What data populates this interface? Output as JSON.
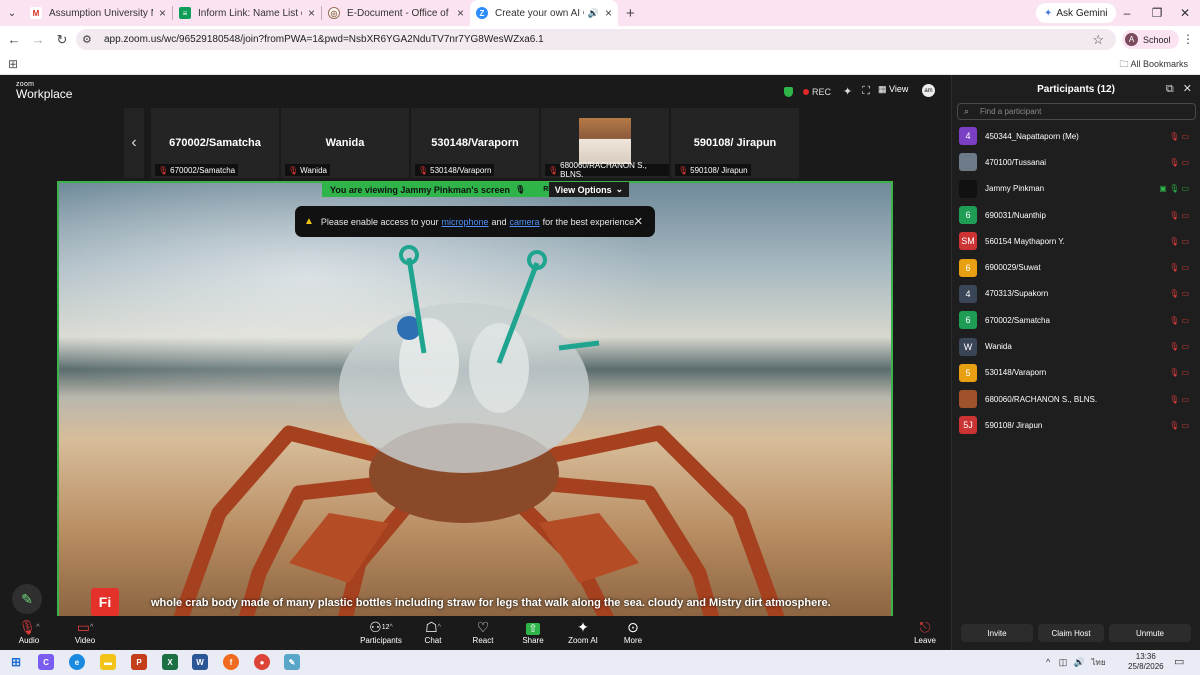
{
  "browser": {
    "tabs": [
      {
        "title": "Assumption University Mail",
        "icon": "gmail-icon",
        "color": "#d93025",
        "glyph": "M"
      },
      {
        "title": "Inform Link: Name List of Partic",
        "icon": "sheets-icon",
        "color": "#0f9d58",
        "glyph": "≡"
      },
      {
        "title": "E-Document - Office of the Vic",
        "icon": "edoc-icon",
        "color": "#9a6b4f",
        "glyph": "◎"
      },
      {
        "title": "Create your own AI Chatbo",
        "icon": "zoom-icon",
        "color": "#2d8cff",
        "glyph": "Z"
      }
    ],
    "ask_gemini": "Ask Gemini",
    "url": "app.zoom.us/wc/96529180548/join?fromPWA=1&pwd=NsbXR6YGA2NduTV7nr7YG8WesWZxa6.1",
    "profile": {
      "initial": "A",
      "label": "School"
    },
    "all_bookmarks": "All Bookmarks"
  },
  "zoom": {
    "logo_small": "zoom",
    "logo_big": "Workplace",
    "rec": "REC",
    "view": "View",
    "gallery": [
      {
        "name": "670002/Samatcha",
        "label": "670002/Samatcha"
      },
      {
        "name": "Wanida",
        "label": "Wanida"
      },
      {
        "name": "530148/Varaporn",
        "label": "530148/Varaporn"
      },
      {
        "name": "",
        "label": "680060/RACHANON S., BLNS."
      },
      {
        "name": "590108/ Jirapun",
        "label": "590108/ Jirapun"
      }
    ],
    "viewing_banner": "You are viewing  Jammy Pinkman's screen",
    "viewing_rec": "REC",
    "view_options": "View Options",
    "toast": {
      "before": "Please enable access to your",
      "mic_link": "microphone",
      "and": "and",
      "cam_link": "camera",
      "after": "for the best experience."
    },
    "fi_badge": "Fi",
    "caption": "whole crab body made of many plastic bottles including straw for legs that walk along the sea. cloudy and Mistry dirt atmosphere.",
    "toolbar": {
      "audio": "Audio",
      "video": "Video",
      "participants": "Participants",
      "participants_count": "12",
      "chat": "Chat",
      "react": "React",
      "share": "Share",
      "zoom_ai": "Zoom AI",
      "more": "More",
      "leave": "Leave"
    }
  },
  "participants": {
    "title": "Participants (12)",
    "search_placeholder": "Find a participant",
    "list": [
      {
        "initial": "4",
        "name": "450344_Napattaporn (Me)",
        "color": "#7b3fc4"
      },
      {
        "initial": "",
        "name": "470100/Tussanai",
        "color": "#6d7a88"
      },
      {
        "initial": "",
        "name": "Jammy Pinkman",
        "color": "#111111"
      },
      {
        "initial": "6",
        "name": "690031/Nuanthip",
        "color": "#1f9d55"
      },
      {
        "initial": "SM",
        "name": "560154 Maythaporn Y.",
        "color": "#cc3333"
      },
      {
        "initial": "6",
        "name": "6900029/Suwat",
        "color": "#e8a012"
      },
      {
        "initial": "4",
        "name": "470313/Supakorn",
        "color": "#3a4658"
      },
      {
        "initial": "6",
        "name": "670002/Samatcha",
        "color": "#1f9d55"
      },
      {
        "initial": "W",
        "name": "Wanida",
        "color": "#3a4658"
      },
      {
        "initial": "5",
        "name": "530148/Varaporn",
        "color": "#e8a012"
      },
      {
        "initial": "",
        "name": "680060/RACHANON S., BLNS.",
        "color": "#a0522d"
      },
      {
        "initial": "5J",
        "name": "590108/ Jirapun",
        "color": "#cc3333"
      }
    ],
    "invite": "Invite",
    "claim_host": "Claim Host",
    "unmute": "Unmute"
  },
  "taskbar": {
    "time": "13:36",
    "date": "25/8/2026",
    "lang": "ไทย"
  }
}
